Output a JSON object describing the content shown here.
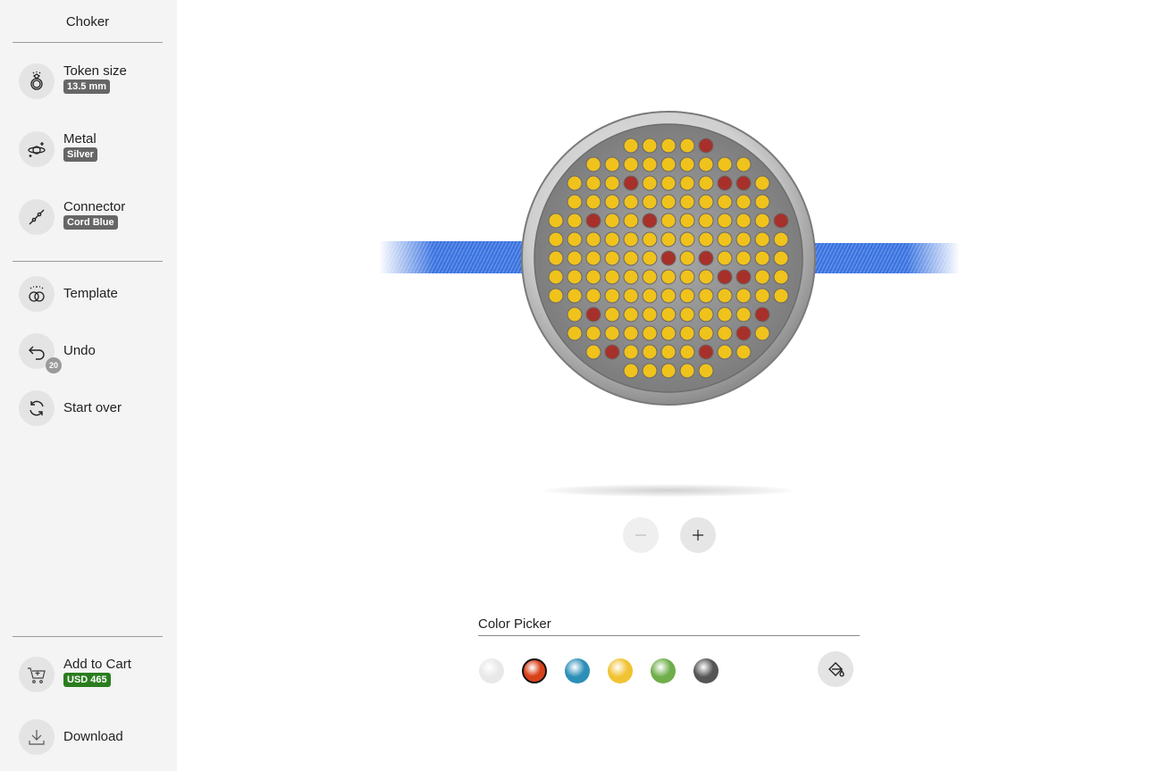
{
  "sidebar": {
    "title": "Choker",
    "token_size": {
      "label": "Token size",
      "badge": "13.5 mm"
    },
    "metal": {
      "label": "Metal",
      "badge": "Silver"
    },
    "connector": {
      "label": "Connector",
      "badge": "Cord Blue"
    },
    "template": {
      "label": "Template"
    },
    "undo": {
      "label": "Undo",
      "count": "20"
    },
    "start_over": {
      "label": "Start over"
    },
    "add_to_cart": {
      "label": "Add to Cart",
      "price": "USD 465"
    },
    "download": {
      "label": "Download"
    }
  },
  "color_picker": {
    "title": "Color Picker",
    "swatches": [
      {
        "name": "clear",
        "color": "#e8e8e8",
        "selected": false
      },
      {
        "name": "red",
        "color": "#d8421a",
        "selected": true
      },
      {
        "name": "blue",
        "color": "#2d8fb8",
        "selected": false
      },
      {
        "name": "yellow",
        "color": "#f1c232",
        "selected": false
      },
      {
        "name": "green",
        "color": "#6fae4a",
        "selected": false
      },
      {
        "name": "black",
        "color": "#555555",
        "selected": false
      }
    ]
  },
  "colors": {
    "cord": "#3a73e0",
    "gem_yellow": "#f0c21c",
    "gem_red": "#a8302a",
    "metal": "#c9c9c9",
    "badge_green": "#2a7d1e"
  },
  "zoom": {
    "out_enabled": false,
    "in_enabled": true
  }
}
